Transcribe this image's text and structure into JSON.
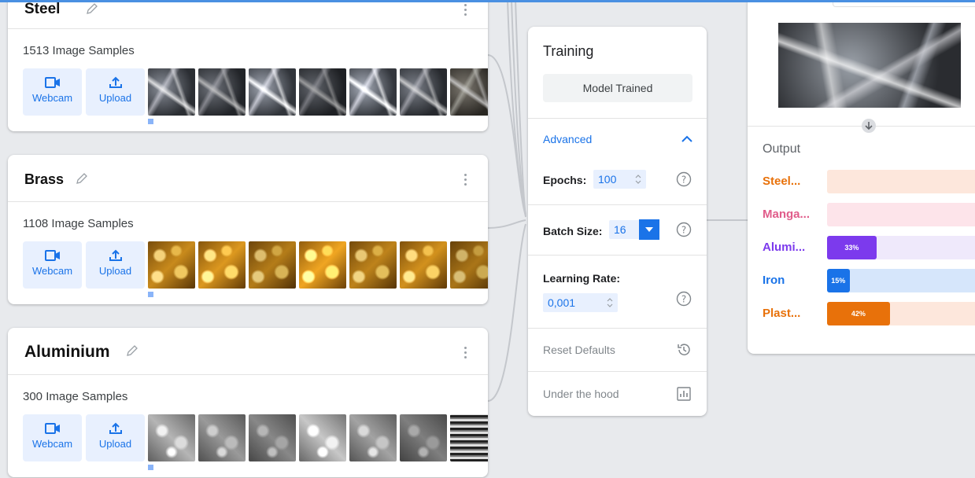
{
  "classes": [
    {
      "name": "Steel",
      "samples": "1513 Image Samples",
      "webcam": "Webcam",
      "upload": "Upload"
    },
    {
      "name": "Brass",
      "samples": "1108 Image Samples",
      "webcam": "Webcam",
      "upload": "Upload"
    },
    {
      "name": "Aluminium",
      "samples": "300 Image Samples",
      "webcam": "Webcam",
      "upload": "Upload"
    }
  ],
  "training": {
    "title": "Training",
    "trained_button": "Model Trained",
    "advanced": "Advanced",
    "epochs_label": "Epochs:",
    "epochs_value": "100",
    "batch_label": "Batch Size:",
    "batch_value": "16",
    "lr_label": "Learning Rate:",
    "lr_value": "0,001",
    "reset": "Reset Defaults",
    "under_hood": "Under the hood"
  },
  "preview": {
    "output_title": "Output",
    "outputs": [
      {
        "label": "Steel...",
        "percent": 0,
        "text": "",
        "color": "#e8710a",
        "track": "#fde7dc"
      },
      {
        "label": "Manga...",
        "percent": 0,
        "text": "",
        "color": "#e05c8a",
        "track": "#fde4ea"
      },
      {
        "label": "Alumi...",
        "percent": 33,
        "text": "33%",
        "color": "#7c3aed",
        "track": "#efe9fb"
      },
      {
        "label": "Iron",
        "percent": 15,
        "text": "15%",
        "color": "#1a73e8",
        "track": "#d6e6fb"
      },
      {
        "label": "Plast...",
        "percent": 42,
        "text": "42%",
        "color": "#e8710a",
        "track": "#fde7dc"
      }
    ]
  },
  "icons": {
    "webcam": "webcam-icon",
    "upload": "upload-icon",
    "edit": "pencil-icon",
    "menu": "kebab-menu-icon",
    "help": "help-circle-icon",
    "reset": "history-icon",
    "chart": "bar-chart-icon"
  },
  "accent_color": "#1a73e8"
}
